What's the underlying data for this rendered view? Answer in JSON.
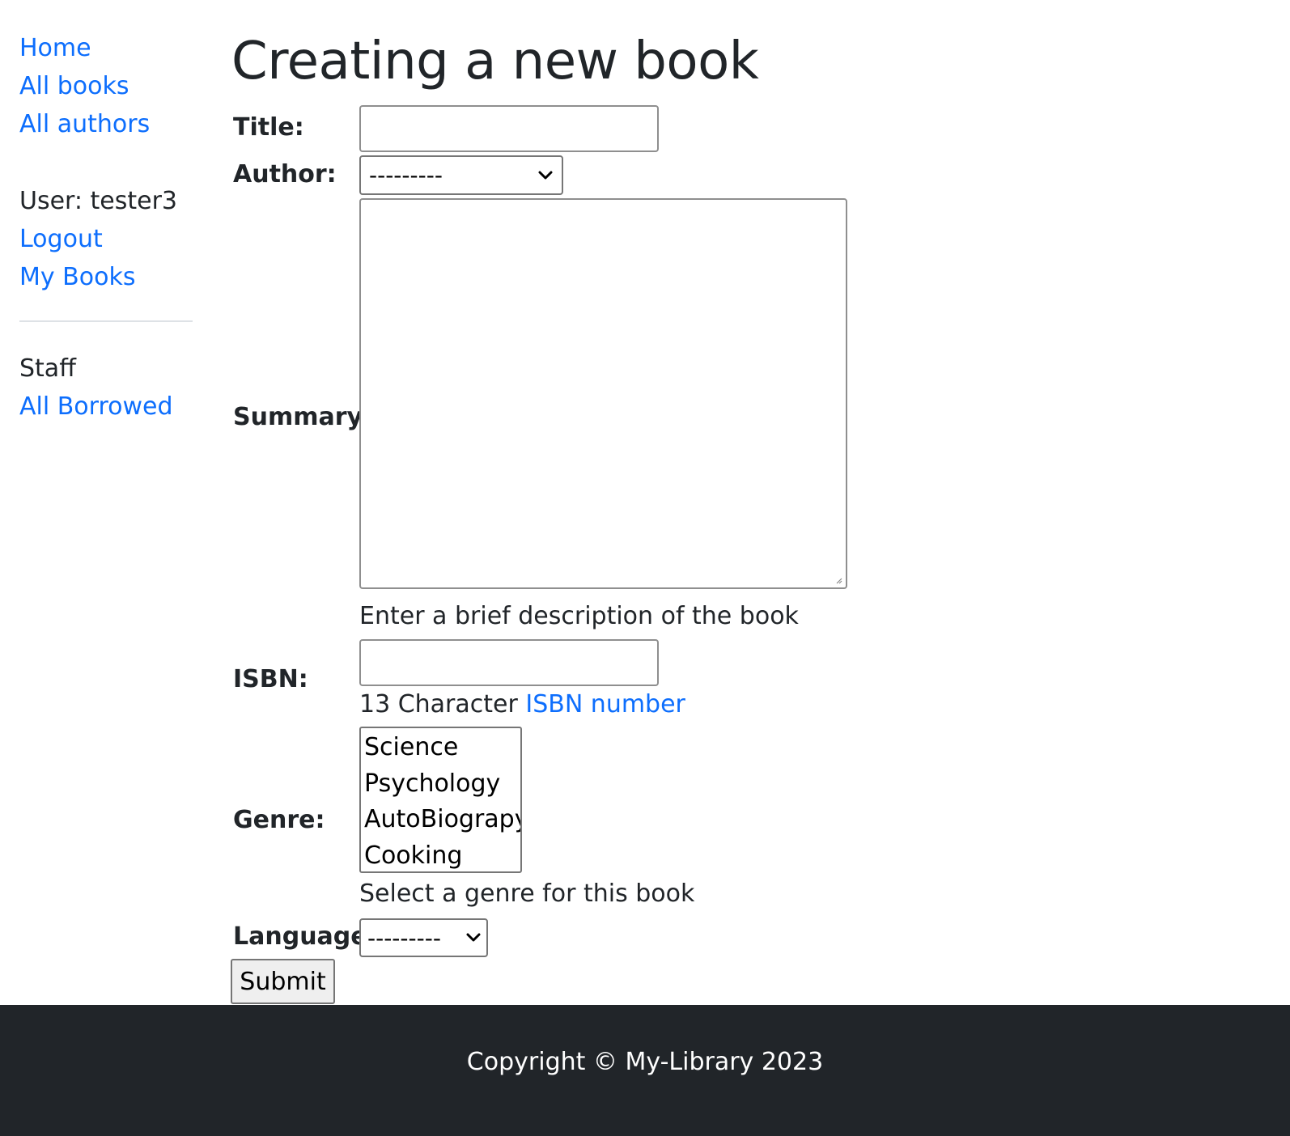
{
  "sidebar": {
    "nav": [
      {
        "label": "Home"
      },
      {
        "label": "All books"
      },
      {
        "label": "All authors"
      }
    ],
    "user_line": "User: tester3",
    "user_links": [
      {
        "label": "Logout"
      },
      {
        "label": "My Books"
      }
    ],
    "staff_label": "Staff",
    "staff_links": [
      {
        "label": "All Borrowed"
      }
    ]
  },
  "main": {
    "title": "Creating a new book",
    "form": {
      "title_label": "Title:",
      "title_value": "",
      "author_label": "Author:",
      "author_selected": "---------",
      "summary_label": "Summary:",
      "summary_value": "",
      "summary_help": "Enter a brief description of the book",
      "isbn_label": "ISBN:",
      "isbn_value": "",
      "isbn_help_prefix": "13 Character ",
      "isbn_help_link": "ISBN number",
      "genre_label": "Genre:",
      "genre_options": [
        "Science",
        "Psychology",
        "AutoBiograpy",
        "Cooking"
      ],
      "genre_help": "Select a genre for this book",
      "language_label": "Language:",
      "language_selected": "---------",
      "submit_label": "Submit"
    }
  },
  "footer": {
    "copyright": "Copyright © My-Library 2023"
  },
  "colors": {
    "link": "#0d6efd",
    "text": "#212529",
    "footer_bg": "#212529"
  }
}
